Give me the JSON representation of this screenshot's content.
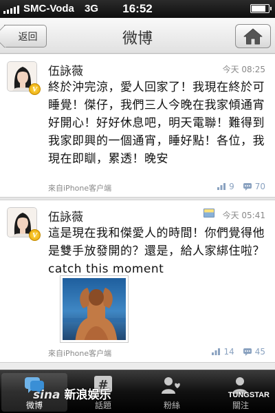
{
  "status": {
    "carrier": "SMC-Voda",
    "network": "3G",
    "time": "16:52",
    "battery_level": 0.85
  },
  "nav": {
    "back_label": "返回",
    "title": "微博",
    "home_icon": "home-icon"
  },
  "posts": [
    {
      "user": "伍詠薇",
      "verified_badge": "V",
      "time": "今天 08:25",
      "text": "終於沖完涼，愛人回家了！我現在終於可睡覺！傑仔，我們三人今晚在我家傾通宵好開心！好好休息吧，明天電聯！難得到我家即興的一個通宵，睡好點！各位，我現在即瞓，累透！晚安",
      "source": "來自iPhone客户端",
      "reposts": "9",
      "comments": "70"
    },
    {
      "user": "伍詠薇",
      "verified_badge": "V",
      "time": "今天 05:41",
      "text": "這是現在我和傑愛人的時間！你們覺得他是雙手放發開的？還是，給人家綁住啦？catch this moment",
      "source": "來自iPhone客户端",
      "reposts": "14",
      "comments": "45",
      "has_image": true
    }
  ],
  "tabs": [
    {
      "label": "微博",
      "icon": "weibo-icon",
      "active": true
    },
    {
      "label": "話題",
      "icon": "hash-icon",
      "active": false
    },
    {
      "label": "粉絲",
      "icon": "fans-icon",
      "active": false
    },
    {
      "label": "關注",
      "icon": "follow-icon",
      "active": false
    }
  ],
  "watermark": {
    "sina": "sina",
    "text": "新浪娱乐",
    "agency": "TUNGSTAR"
  },
  "colors": {
    "accent": "#8aa2c0",
    "tabbar": "#111111"
  }
}
